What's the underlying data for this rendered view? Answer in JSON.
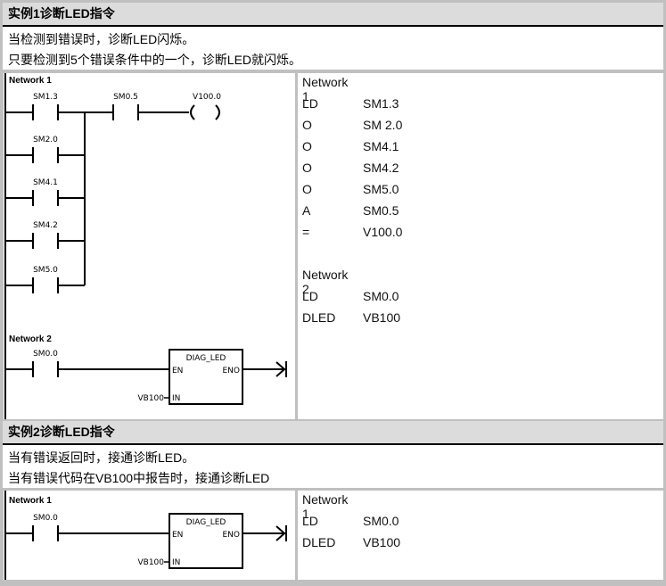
{
  "example1": {
    "title": "实例1诊断LED指令",
    "description": [
      "当检测到错误时，诊断LED闪烁。",
      "只要检测到5个错误条件中的一个，诊断LED就闪烁。"
    ],
    "ladder": {
      "network1": {
        "label": "Network 1",
        "series_contact": "SM1.3",
        "and_contact": "SM0.5",
        "coil": "V100.0",
        "parallel_contacts": [
          "SM2.0",
          "SM4.1",
          "SM4.2",
          "SM5.0"
        ]
      },
      "network2": {
        "label": "Network 2",
        "contact": "SM0.0",
        "box_title": "DIAG_LED",
        "en": "EN",
        "eno": "ENO",
        "in_label": "IN",
        "in_value": "VB100"
      }
    },
    "stl": [
      {
        "op": "Network 1",
        "arg": ""
      },
      {
        "op": "LD",
        "arg": "SM1.3"
      },
      {
        "op": "O",
        "arg": "SM 2.0"
      },
      {
        "op": "O",
        "arg": "SM4.1"
      },
      {
        "op": "O",
        "arg": "SM4.2"
      },
      {
        "op": "O",
        "arg": "SM5.0"
      },
      {
        "op": "A",
        "arg": "SM0.5"
      },
      {
        "op": "=",
        "arg": "V100.0"
      },
      {
        "op": "",
        "arg": ""
      },
      {
        "op": "Network 2",
        "arg": ""
      },
      {
        "op": "LD",
        "arg": "SM0.0"
      },
      {
        "op": "DLED",
        "arg": "VB100"
      }
    ]
  },
  "example2": {
    "title": "实例2诊断LED指令",
    "description": [
      "当有错误返回时，接通诊断LED。",
      "当有错误代码在VB100中报告时，接通诊断LED"
    ],
    "ladder": {
      "network1": {
        "label": "Network 1",
        "contact": "SM0.0",
        "box_title": "DIAG_LED",
        "en": "EN",
        "eno": "ENO",
        "in_label": "IN",
        "in_value": "VB100"
      }
    },
    "stl": [
      {
        "op": "Network 1",
        "arg": ""
      },
      {
        "op": "LD",
        "arg": "SM0.0"
      },
      {
        "op": "DLED",
        "arg": "VB100"
      }
    ]
  }
}
